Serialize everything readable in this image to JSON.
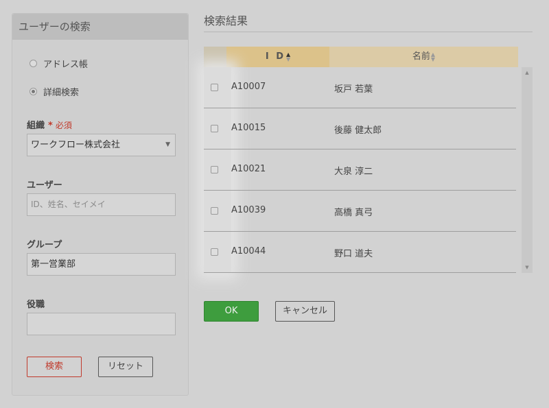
{
  "search_panel": {
    "title": "ユーザーの検索",
    "radios": [
      {
        "label": "アドレス帳",
        "checked": false
      },
      {
        "label": "詳細検索",
        "checked": true
      }
    ],
    "org": {
      "label": "組織",
      "required_star": "*",
      "required_text": "必須",
      "value": "ワークフロー株式会社"
    },
    "user": {
      "label": "ユーザー",
      "placeholder": "ID、姓名、セイメイ"
    },
    "group": {
      "label": "グループ",
      "value": "第一営業部"
    },
    "position": {
      "label": "役職",
      "value": ""
    },
    "search_button": "検索",
    "reset_button": "リセット"
  },
  "results": {
    "title": "検索結果",
    "columns": {
      "id": "I D",
      "name": "名前"
    },
    "rows": [
      {
        "id": "A10007",
        "name": "坂戸 若葉"
      },
      {
        "id": "A10015",
        "name": "後藤 健太郎"
      },
      {
        "id": "A10021",
        "name": "大泉 淳二"
      },
      {
        "id": "A10039",
        "name": "高橋 真弓"
      },
      {
        "id": "A10044",
        "name": "野口 道夫"
      }
    ],
    "ok_button": "OK",
    "cancel_button": "キャンセル"
  },
  "icons": {
    "sort_up": "▲",
    "sort_down": "▼",
    "select_arrow": "▼",
    "scroll_up": "▲",
    "scroll_down": "▼"
  }
}
